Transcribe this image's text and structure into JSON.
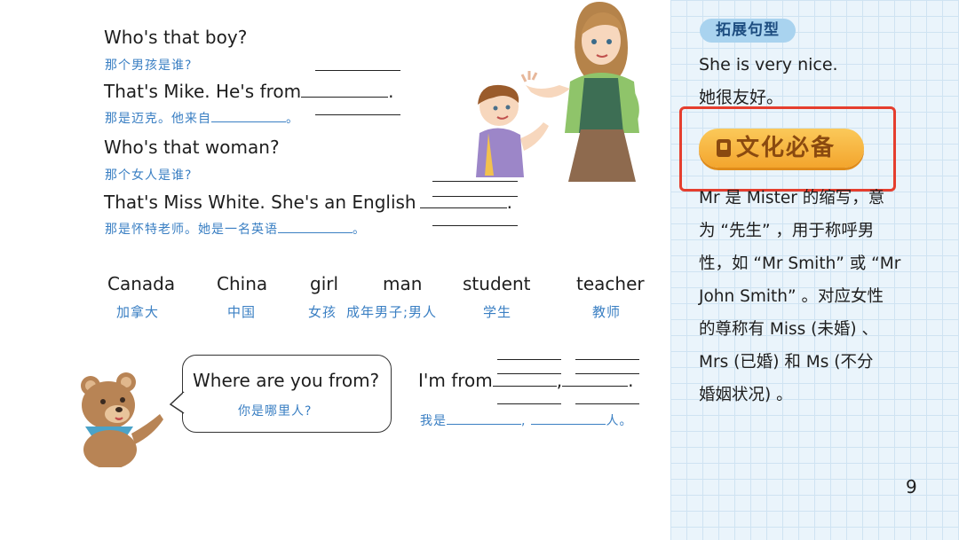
{
  "dialogue": {
    "q1_en": "Who's that boy?",
    "q1_cn": "那个男孩是谁?",
    "a1_en": "That's Mike. He's from",
    "a1_cn": "那是迈克。他来自",
    "q2_en": "Who's that woman?",
    "q2_cn": "那个女人是谁?",
    "a2_en": "That's Miss White. She's an English",
    "a2_cn": "那是怀特老师。她是一名英语",
    "period": ".",
    "period_cn": "。"
  },
  "words": [
    {
      "en": "Canada",
      "cn": "加拿大"
    },
    {
      "en": "China",
      "cn": "中国"
    },
    {
      "en": "girl",
      "cn": "女孩"
    },
    {
      "en": "man",
      "cn": "成年男子;男人"
    },
    {
      "en": "student",
      "cn": "学生"
    },
    {
      "en": "teacher",
      "cn": "教师"
    }
  ],
  "bubble": {
    "question_en": "Where are you from?",
    "question_cn": "你是哪里人?"
  },
  "answer": {
    "en": "I'm from",
    "comma": ",",
    "period": ".",
    "cn_prefix": "我是",
    "cn_comma": ",",
    "cn_suffix": "人。"
  },
  "sidebar": {
    "tag": "拓展句型",
    "sentence_en": "She is very nice.",
    "sentence_cn": "她很友好。",
    "culture_label": "文化必备",
    "body_lines": [
      "Mr 是 Mister 的缩写，意",
      "为 “先生” ，用于称呼男",
      "性，如 “Mr Smith” 或 “Mr",
      "John Smith” 。对应女性",
      "的尊称有 Miss (未婚) 、",
      "Mrs (已婚) 和 Ms (不分",
      "婚姻状况) 。"
    ]
  },
  "page_number": "9",
  "colors": {
    "chinese_text": "#3a7fc3",
    "sidebar_bg": "#eaf4fb",
    "highlight_box": "#e53e2e",
    "culture_button": "#f3a52d"
  },
  "icons": [
    "book-icon"
  ]
}
